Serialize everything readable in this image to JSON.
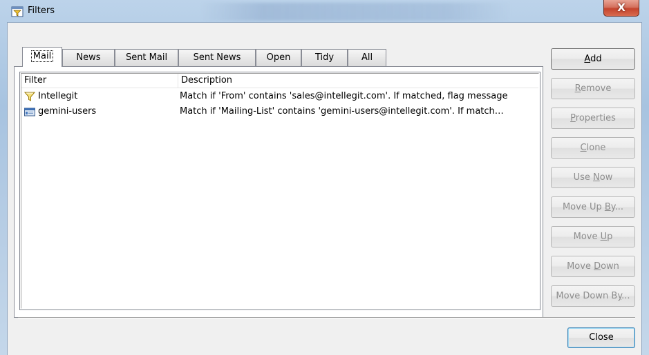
{
  "window": {
    "title": "Filters",
    "close_glyph": "X"
  },
  "tabs": [
    {
      "label": "Mail",
      "active": true
    },
    {
      "label": "News",
      "active": false
    },
    {
      "label": "Sent Mail",
      "active": false
    },
    {
      "label": "Sent News",
      "active": false
    },
    {
      "label": "Open",
      "active": false
    },
    {
      "label": "Tidy",
      "active": false
    },
    {
      "label": "All",
      "active": false
    }
  ],
  "list": {
    "columns": [
      "Filter",
      "Description"
    ],
    "rows": [
      {
        "name": "Intellegit",
        "description": "Match if 'From' contains 'sales@intellegit.com'. If matched, flag message",
        "icon": "funnel-icon"
      },
      {
        "name": "gemini-users",
        "description": "Match if 'Mailing-List' contains 'gemini-users@intellegit.com'. If match…",
        "icon": "mailing-list-icon"
      }
    ]
  },
  "buttons": {
    "add": {
      "pre": "",
      "key": "A",
      "post": "dd",
      "enabled": true
    },
    "remove": {
      "pre": "",
      "key": "R",
      "post": "emove",
      "enabled": false
    },
    "properties": {
      "pre": "",
      "key": "P",
      "post": "roperties",
      "enabled": false
    },
    "clone": {
      "pre": "",
      "key": "C",
      "post": "lone",
      "enabled": false
    },
    "use_now": {
      "pre": "Use ",
      "key": "N",
      "post": "ow",
      "enabled": false
    },
    "move_up_by": {
      "pre": "Move Up ",
      "key": "B",
      "post": "y...",
      "enabled": false
    },
    "move_up": {
      "pre": "Move ",
      "key": "U",
      "post": "p",
      "enabled": false
    },
    "move_down": {
      "pre": "Move ",
      "key": "D",
      "post": "own",
      "enabled": false
    },
    "move_down_by": {
      "pre": "Move Down B",
      "key": "y",
      "post": "...",
      "enabled": false
    },
    "close": {
      "label": "Close",
      "enabled": true
    }
  }
}
